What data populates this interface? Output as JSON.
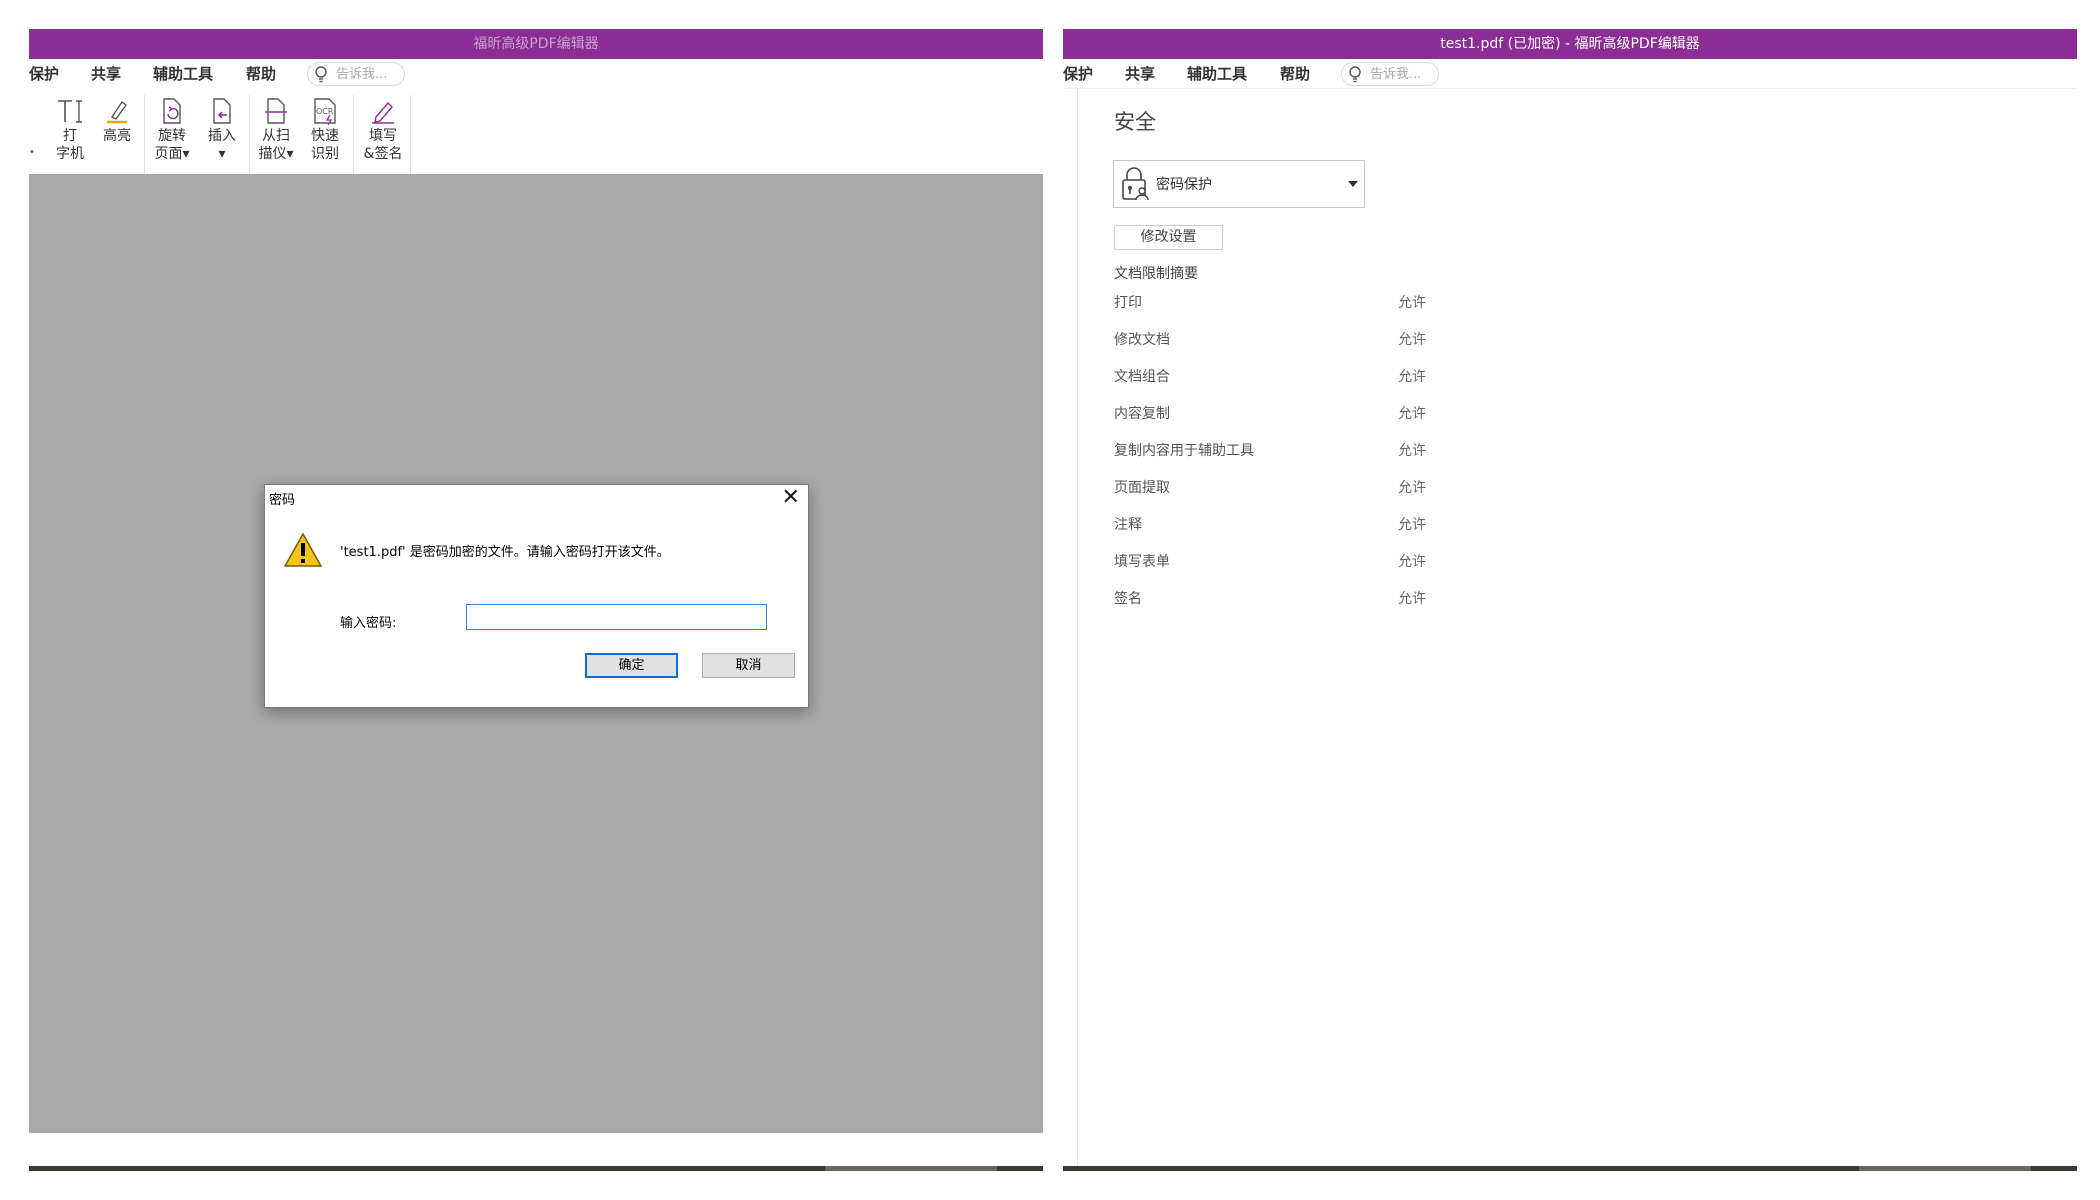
{
  "left_window": {
    "title": "福昕高级PDF编辑器",
    "menu": [
      "保护",
      "共享",
      "辅助工具",
      "帮助"
    ],
    "tell_me_placeholder": "告诉我...",
    "tools": [
      {
        "line1": "打",
        "line2": "字机"
      },
      {
        "line1": "高亮",
        "line2": ""
      },
      {
        "line1": "旋转",
        "line2": "页面▾"
      },
      {
        "line1": "插入",
        "line2": "▾"
      },
      {
        "line1": "从扫",
        "line2": "描仪▾"
      },
      {
        "line1": "快速",
        "line2": "识别"
      },
      {
        "line1": "填写",
        "line2": "&签名"
      }
    ],
    "dialog": {
      "title": "密码",
      "message": "'test1.pdf' 是密码加密的文件。请输入密码打开该文件。",
      "input_label": "输入密码:",
      "password_value": "",
      "ok_label": "确定",
      "cancel_label": "取消"
    }
  },
  "right_window": {
    "title": "test1.pdf (已加密) - 福昕高级PDF编辑器",
    "menu": [
      "保护",
      "共享",
      "辅助工具",
      "帮助"
    ],
    "tell_me_placeholder": "告诉我...",
    "security": {
      "title": "安全",
      "method": "密码保护",
      "modify_button": "修改设置",
      "summary_title": "文档限制摘要",
      "permissions": [
        {
          "name": "打印",
          "value": "允许"
        },
        {
          "name": "修改文档",
          "value": "允许"
        },
        {
          "name": "文档组合",
          "value": "允许"
        },
        {
          "name": "内容复制",
          "value": "允许"
        },
        {
          "name": "复制内容用于辅助工具",
          "value": "允许"
        },
        {
          "name": "页面提取",
          "value": "允许"
        },
        {
          "name": "注释",
          "value": "允许"
        },
        {
          "name": "填写表单",
          "value": "允许"
        },
        {
          "name": "签名",
          "value": "允许"
        }
      ]
    }
  },
  "colors": {
    "titlebar": "#8b2d94",
    "doc_background": "#a9a9a9",
    "accent_blue": "#0f6fd1"
  }
}
